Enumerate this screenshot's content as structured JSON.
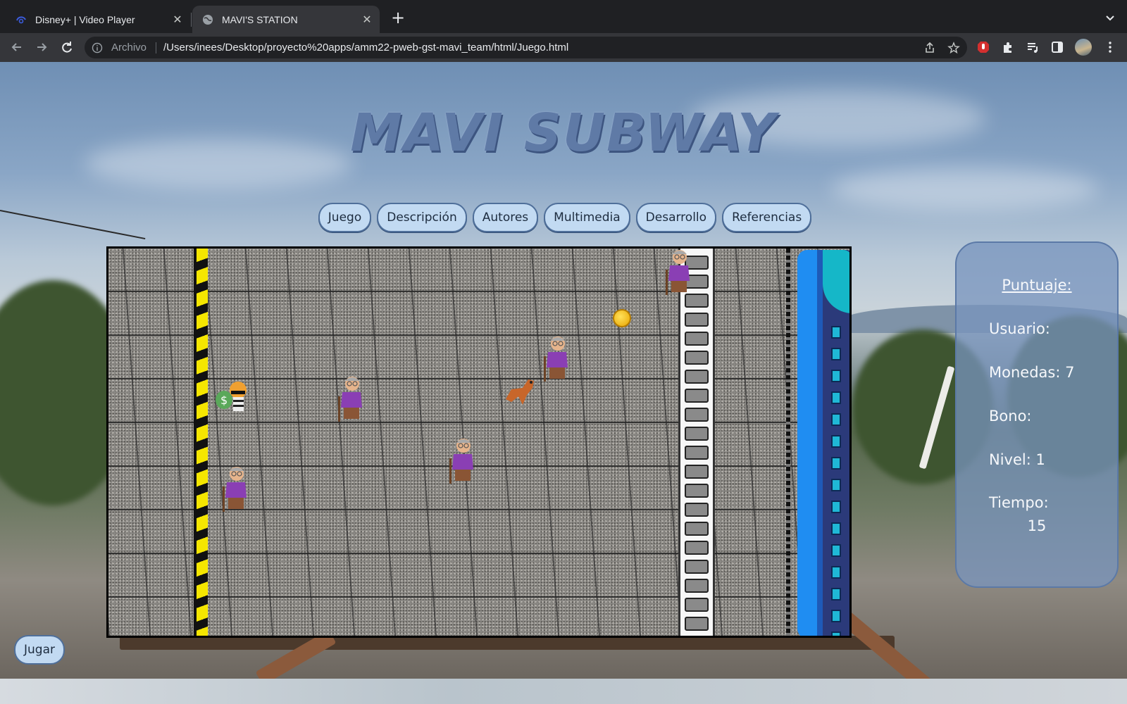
{
  "browser": {
    "tabs": [
      {
        "title": "Disney+ | Video Player",
        "active": false,
        "icon": "disney-plus-icon"
      },
      {
        "title": "MAVI'S STATION",
        "active": true,
        "icon": "globe-icon"
      }
    ],
    "new_tab_label": "+",
    "address": {
      "scheme_label": "Archivo",
      "url": "/Users/inees/Desktop/proyecto%20apps/amm22-pweb-gst-mavi_team/html/Juego.html"
    }
  },
  "page": {
    "title": "MAVI SUBWAY",
    "nav": [
      "Juego",
      "Descripción",
      "Autores",
      "Multimedia",
      "Desarrollo",
      "Referencias"
    ],
    "play_button": "Jugar",
    "scoreboard": {
      "title": "Puntuaje:",
      "user_label": "Usuario:",
      "coins_label": "Monedas: 7",
      "bonus_label": "Bono:",
      "level_label": "Nivel: 1",
      "time_label": "Tiempo:",
      "time_value": "15"
    }
  },
  "colors": {
    "nav_button_bg": "#c2daf2",
    "nav_button_border": "#4f6f9a",
    "title_color": "#5f7aa6",
    "panel_bg": "#7894be",
    "hazard_yellow": "#f5e600",
    "train_blue": "#1f8df2"
  }
}
